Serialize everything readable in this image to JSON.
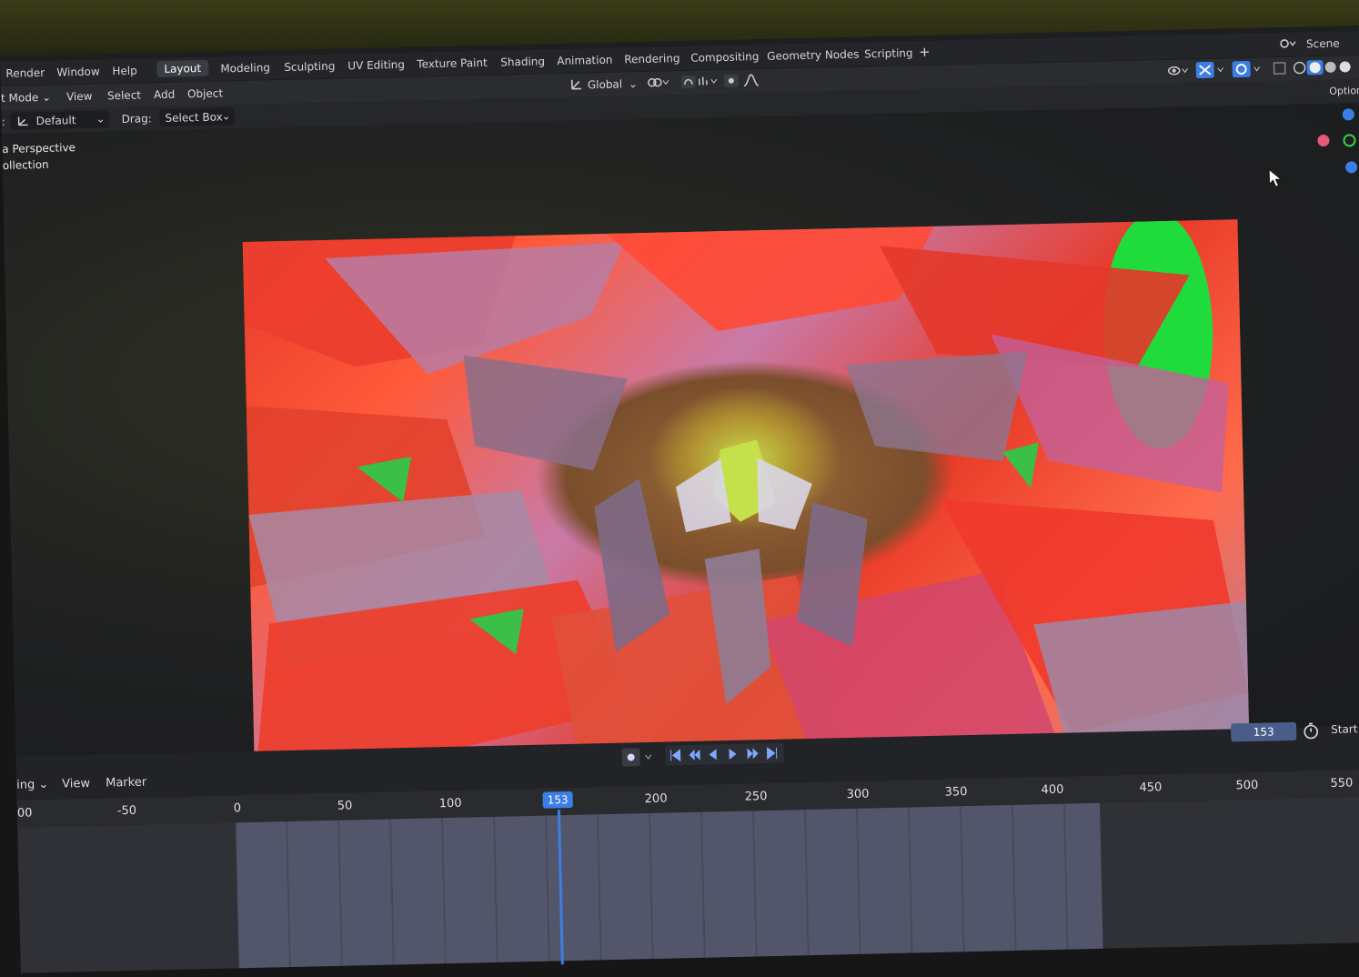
{
  "menu": {
    "items": [
      "Render",
      "Window",
      "Help"
    ]
  },
  "workspaces": [
    "Layout",
    "Modeling",
    "Sculpting",
    "UV Editing",
    "Texture Paint",
    "Shading",
    "Animation",
    "Rendering",
    "Compositing",
    "Geometry Nodes",
    "Scripting"
  ],
  "workspace_add": "+",
  "scene": "Scene",
  "header": {
    "mode": "t Mode",
    "view": "View",
    "select": "Select",
    "add": "Add",
    "object": "Object",
    "transform_orientation": "Global"
  },
  "tool_settings": {
    "orientation_prefix": ":",
    "orientation": "Default",
    "drag_label": "Drag:",
    "drag_value": "Select Box",
    "options": "Options"
  },
  "viewport": {
    "view_name": "a Perspective",
    "collection": "ollection"
  },
  "timeline": {
    "mode": "ing",
    "view": "View",
    "marker": "Marker",
    "current_frame": "153",
    "start_label": "Start",
    "ruler_ticks": [
      "00",
      "-50",
      "0",
      "50",
      "100",
      "200",
      "250",
      "300",
      "350",
      "400",
      "450",
      "500",
      "550"
    ]
  },
  "colors": {
    "accent": "#3d7ee6",
    "gizmo_x": "#e35a7a",
    "gizmo_y": "#3ccf4a",
    "gizmo_z": "#3a7ee8"
  }
}
